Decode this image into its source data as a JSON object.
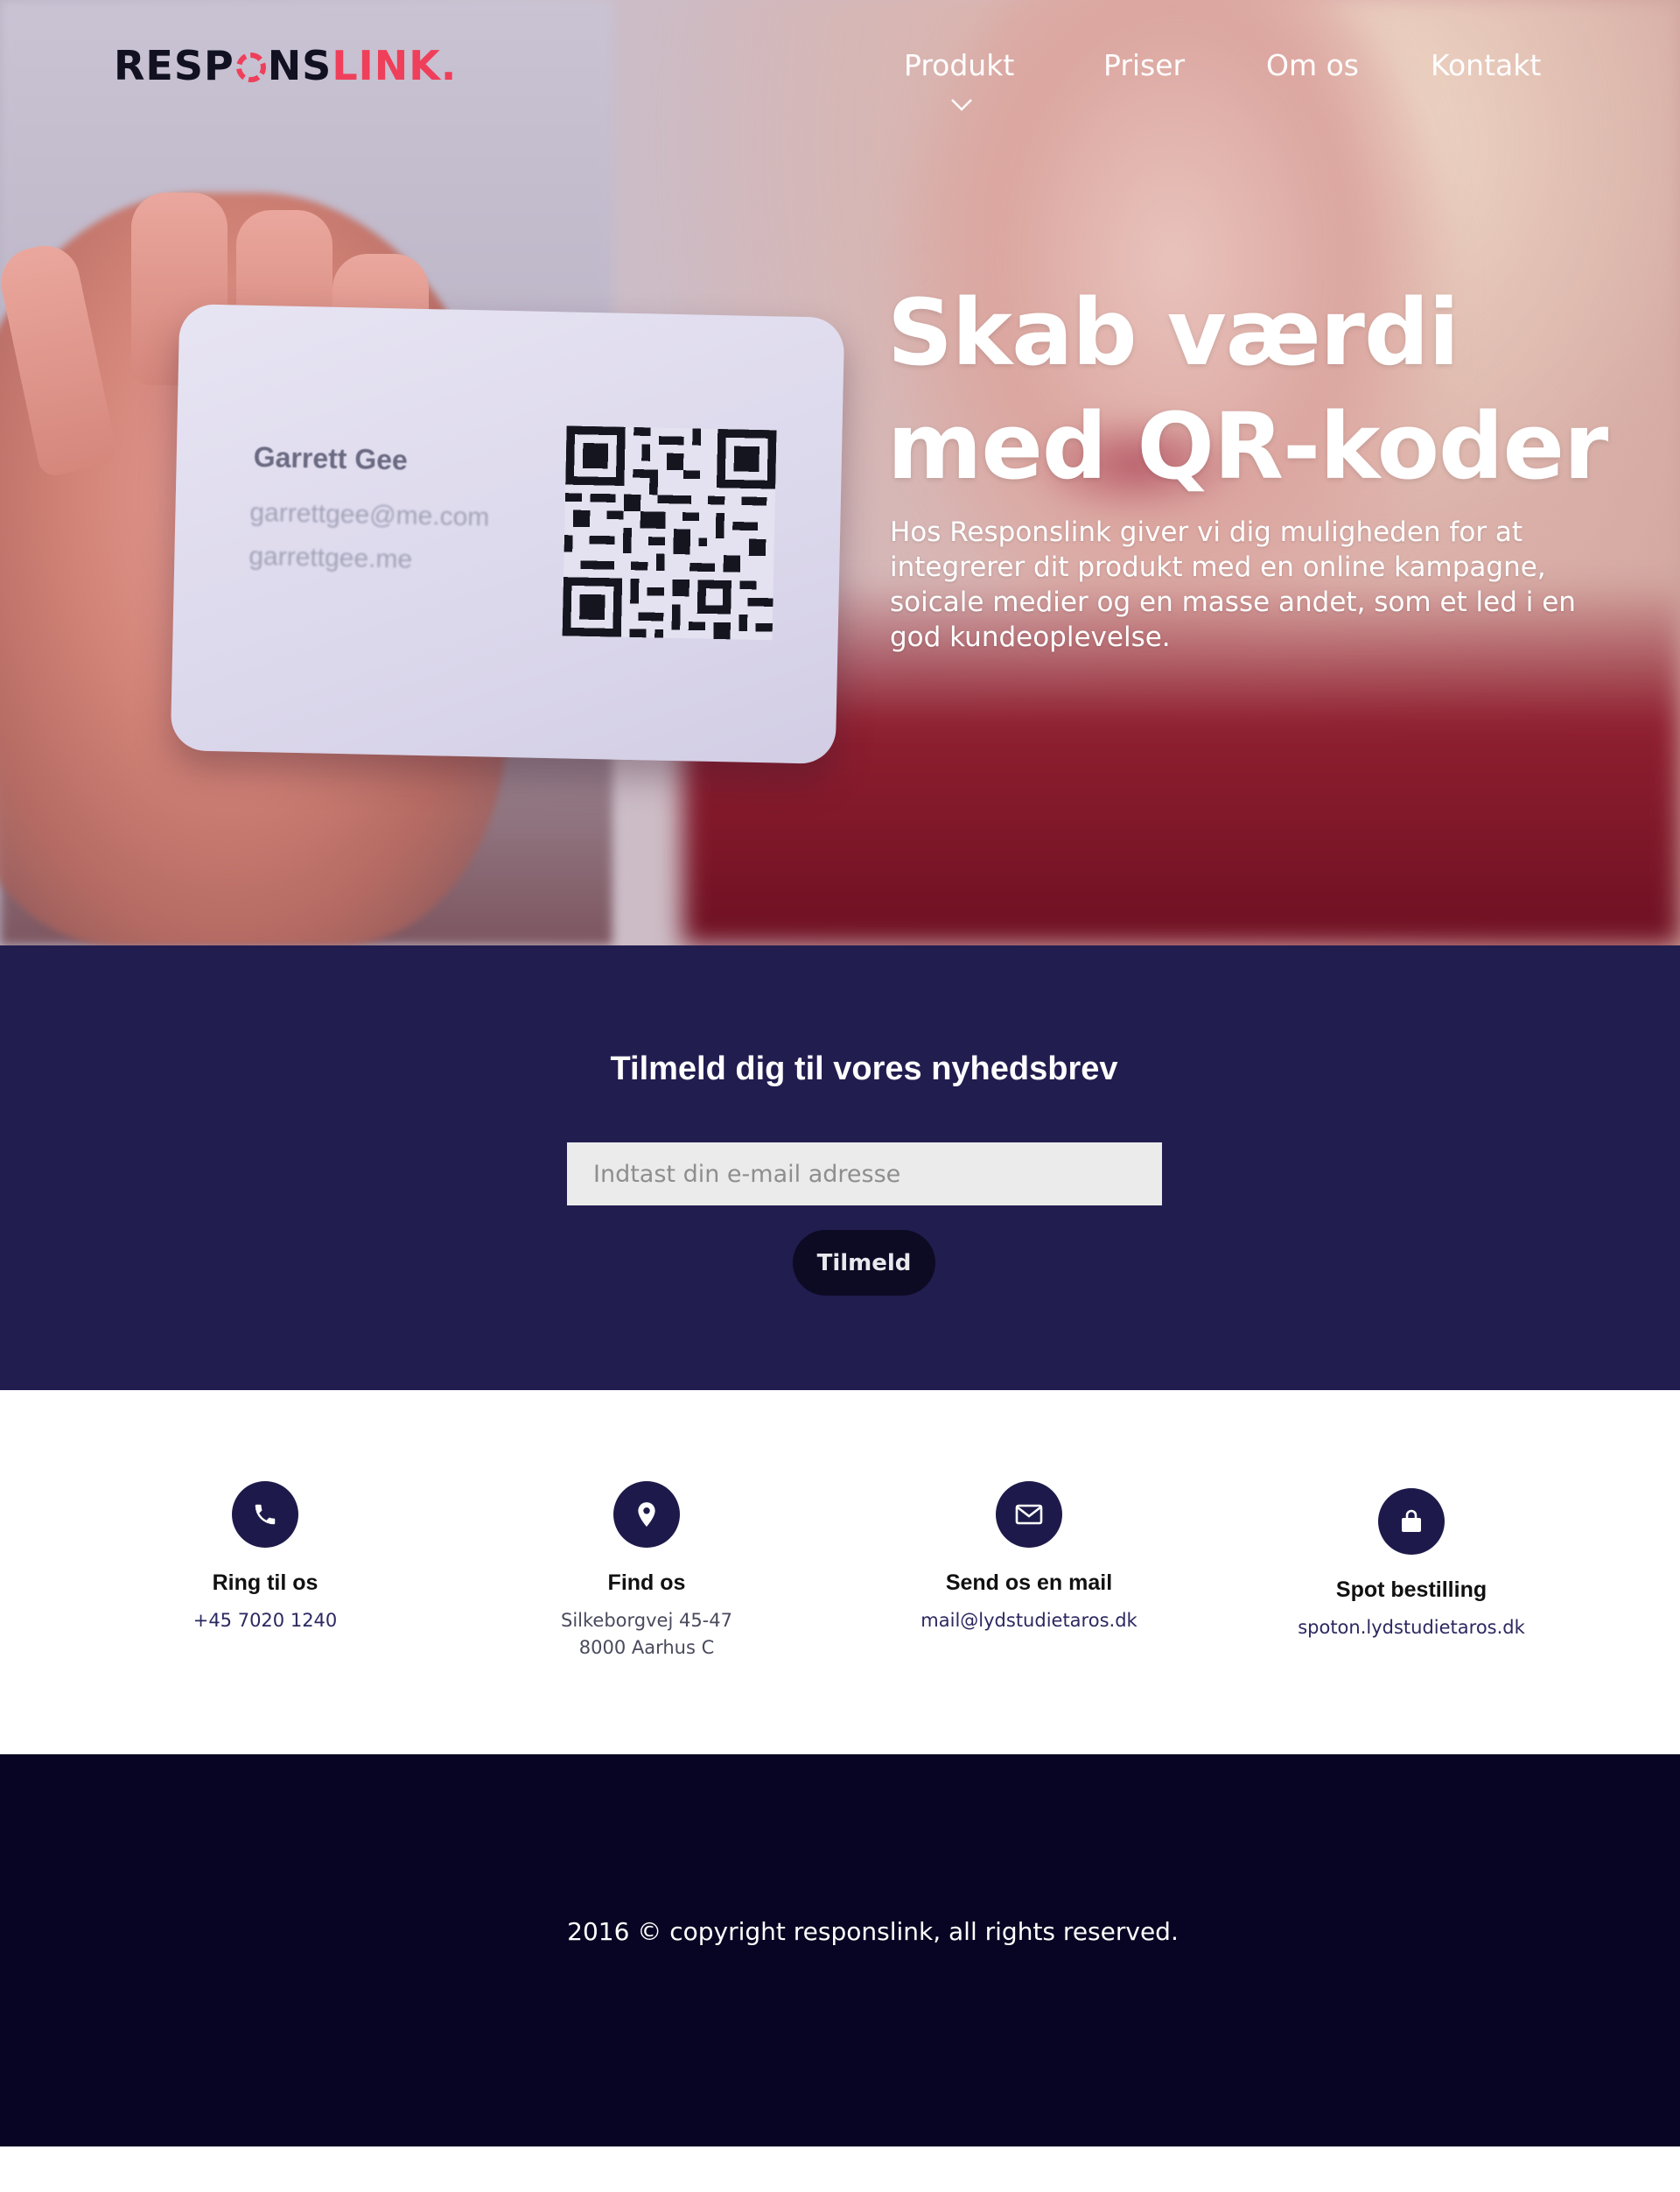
{
  "brand": {
    "logo_part1": "RESP",
    "logo_part2": "NS",
    "logo_part3": "LINK.",
    "accent_color": "#ef3f5a",
    "navy_color": "#211d4f"
  },
  "nav": {
    "items": [
      {
        "label": "Produkt"
      },
      {
        "label": "Priser"
      },
      {
        "label": "Om os"
      },
      {
        "label": "Kontakt"
      }
    ],
    "dropdown_icon": "chevron-down-icon"
  },
  "hero": {
    "title": "Skab værdi med QR-koder",
    "text": "Hos Responslink giver vi dig muligheden for at integrerer dit produkt med en online kampagne, soicale medier og en masse andet, som et led i en god kundeoplevelse.",
    "card": {
      "name": "Garrett Gee",
      "email": "garrettgee@me.com",
      "website": "garrettgee.me"
    }
  },
  "newsletter": {
    "title": "Tilmeld dig til vores nyhedsbrev",
    "input_placeholder": "Indtast din e-mail adresse",
    "button_label": "Tilmeld"
  },
  "contact": {
    "items": [
      {
        "icon": "phone-icon",
        "title": "Ring til os",
        "lines": [
          "+45 7020 1240"
        ]
      },
      {
        "icon": "map-pin-icon",
        "title": "Find os",
        "lines": [
          "Silkeborgvej 45-47",
          "8000 Aarhus C"
        ]
      },
      {
        "icon": "envelope-icon",
        "title": "Send os en mail",
        "lines": [
          "mail@lydstudietaros.dk"
        ]
      },
      {
        "icon": "shopping-bag-icon",
        "title": "Spot bestilling",
        "lines": [
          "spoton.lydstudietaros.dk"
        ]
      }
    ]
  },
  "footer": {
    "copyright": "2016 © copyright responslink, all rights reserved."
  }
}
